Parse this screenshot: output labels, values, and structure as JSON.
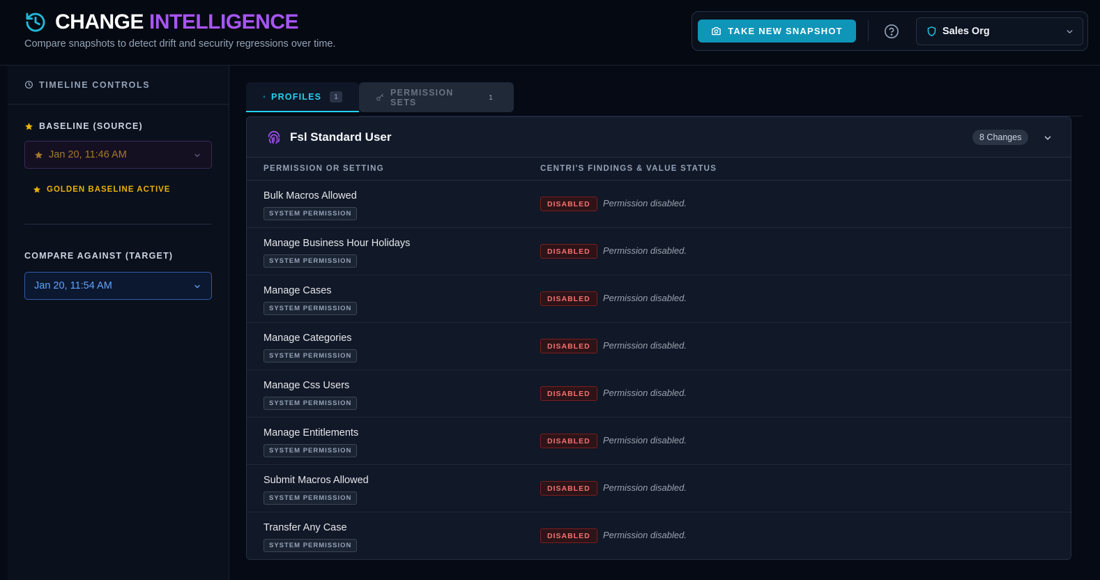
{
  "header": {
    "title_word1": "CHANGE",
    "title_word2": "INTELLIGENCE",
    "subtitle": "Compare snapshots to detect drift and security regressions over time.",
    "snapshot_button": "TAKE NEW SNAPSHOT",
    "org_name": "Sales Org",
    "icons": [
      "history-icon",
      "camera-icon",
      "help-icon",
      "shield-icon",
      "chevron-down-icon"
    ],
    "accent_color": "#a855f7",
    "brand_color": "#0e95b8"
  },
  "sidebar": {
    "heading": "TIMELINE CONTROLS",
    "baseline_label": "BASELINE (SOURCE)",
    "baseline_value": "Jan 20, 11:46 AM",
    "golden_badge": "GOLDEN BASELINE ACTIVE",
    "target_label": "COMPARE AGAINST (TARGET)",
    "target_value": "Jan 20, 11:54 AM"
  },
  "tabs": [
    {
      "label": "PROFILES",
      "count": "1",
      "active": true
    },
    {
      "label": "PERMISSION SETS",
      "count": "1",
      "active": false
    }
  ],
  "panel": {
    "title": "Fsl Standard User",
    "changes": "8 Changes",
    "col_setting": "PERMISSION OR SETTING",
    "col_findings": "CENTRI'S FINDINGS & VALUE STATUS",
    "rows": [
      {
        "name": "Bulk Macros Allowed",
        "type": "SYSTEM PERMISSION",
        "status": "DISABLED",
        "finding": "Permission disabled."
      },
      {
        "name": "Manage Business Hour Holidays",
        "type": "SYSTEM PERMISSION",
        "status": "DISABLED",
        "finding": "Permission disabled."
      },
      {
        "name": "Manage Cases",
        "type": "SYSTEM PERMISSION",
        "status": "DISABLED",
        "finding": "Permission disabled."
      },
      {
        "name": "Manage Categories",
        "type": "SYSTEM PERMISSION",
        "status": "DISABLED",
        "finding": "Permission disabled."
      },
      {
        "name": "Manage Css Users",
        "type": "SYSTEM PERMISSION",
        "status": "DISABLED",
        "finding": "Permission disabled."
      },
      {
        "name": "Manage Entitlements",
        "type": "SYSTEM PERMISSION",
        "status": "DISABLED",
        "finding": "Permission disabled."
      },
      {
        "name": "Submit Macros Allowed",
        "type": "SYSTEM PERMISSION",
        "status": "DISABLED",
        "finding": "Permission disabled."
      },
      {
        "name": "Transfer Any Case",
        "type": "SYSTEM PERMISSION",
        "status": "DISABLED",
        "finding": "Permission disabled."
      }
    ]
  }
}
